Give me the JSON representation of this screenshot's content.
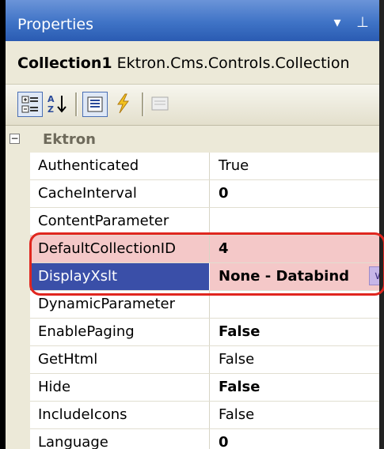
{
  "panel": {
    "title": "Properties",
    "dropdown_glyph": "▾",
    "pin_glyph": "⊥"
  },
  "selector": {
    "object_name": "Collection1",
    "object_type": "Ektron.Cms.Controls.Collection"
  },
  "toolbar": {
    "tools": [
      "categorized-icon",
      "alphabetical-icon",
      "properties-icon",
      "events-icon",
      "property-pages-icon"
    ]
  },
  "category": {
    "toggle": "−",
    "label": "Ektron"
  },
  "properties": [
    {
      "name": "Authenticated",
      "value": "True",
      "bold": false
    },
    {
      "name": "CacheInterval",
      "value": "0",
      "bold": true
    },
    {
      "name": "ContentParameter",
      "value": "",
      "bold": false
    },
    {
      "name": "DefaultCollectionID",
      "value": "4",
      "bold": true,
      "highlighted": true
    },
    {
      "name": "DisplayXslt",
      "value": "None - Databind",
      "bold": true,
      "selected": true
    },
    {
      "name": "DynamicParameter",
      "value": "",
      "bold": false
    },
    {
      "name": "EnablePaging",
      "value": "False",
      "bold": true
    },
    {
      "name": "GetHtml",
      "value": "False",
      "bold": false
    },
    {
      "name": "Hide",
      "value": "False",
      "bold": true
    },
    {
      "name": "IncludeIcons",
      "value": "False",
      "bold": false
    },
    {
      "name": "Language",
      "value": "0",
      "bold": true
    }
  ],
  "colors": {
    "titlebar": "#3f73c6",
    "highlight": "#f4c8c8",
    "selection": "#3a4fa8",
    "annotation_outline": "#e0261f"
  }
}
